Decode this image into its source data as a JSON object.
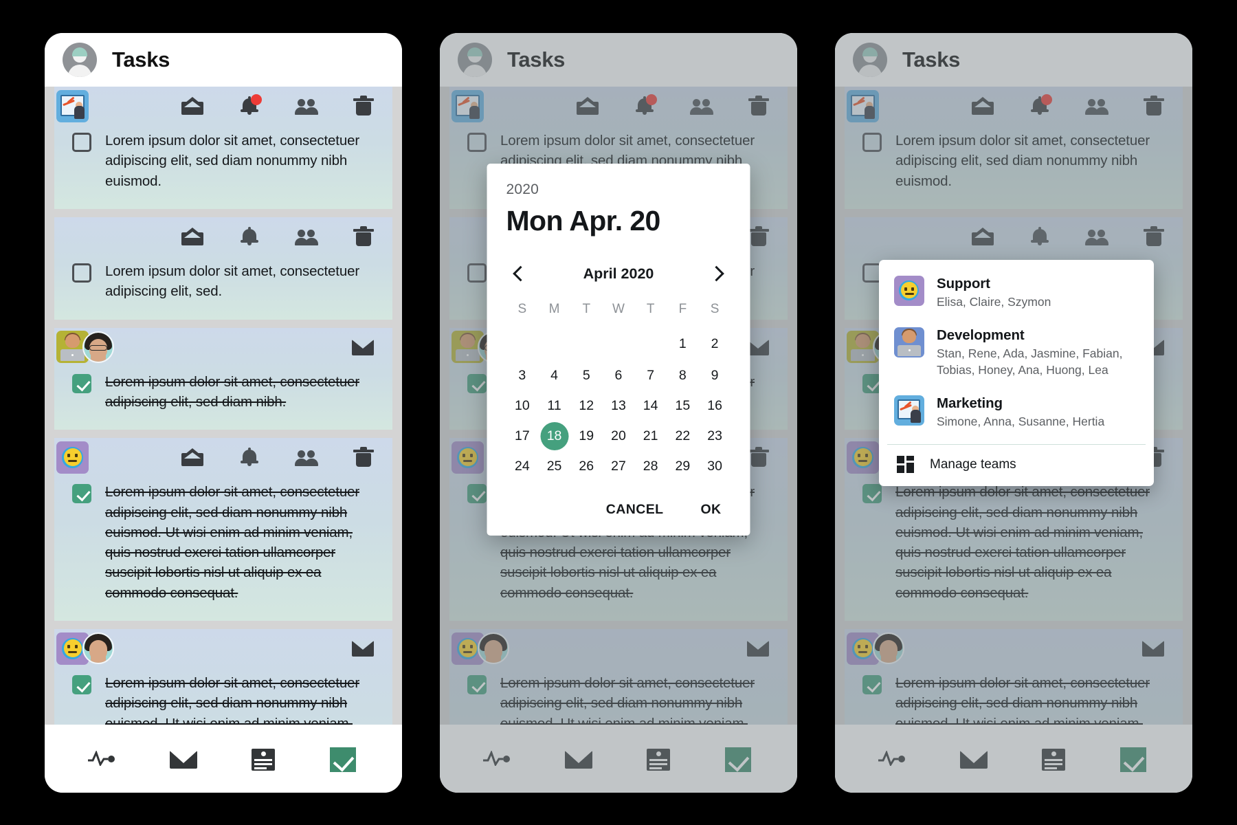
{
  "app": {
    "title": "Tasks",
    "accent_green": "#45a07e",
    "badge_red": "#ed3b37",
    "card_gradient_top": "#cdd9ea",
    "card_gradient_bottom": "#d4e7e0"
  },
  "header": {
    "title": "Tasks",
    "avatar_name": "user-avatar"
  },
  "tasks": [
    {
      "id": "task-1",
      "team_badge": "marketing-badge-icon",
      "avatars": [],
      "icons": [
        "mail-icon",
        "bell-icon",
        "people-icon",
        "trash-icon"
      ],
      "bell_badge": true,
      "checked": false,
      "text": "Lorem ipsum dolor sit amet, consectetuer adipiscing elit, sed diam nonummy nibh euismod."
    },
    {
      "id": "task-2",
      "team_badge": null,
      "avatars": [],
      "icons": [
        "mail-icon",
        "bell-icon",
        "people-icon",
        "trash-icon"
      ],
      "bell_badge": false,
      "checked": false,
      "text": "Lorem ipsum dolor sit amet, consectetuer adipiscing elit, sed."
    },
    {
      "id": "task-3",
      "team_badge": "development-badge-icon",
      "avatars": [
        "avatar-woman-glasses"
      ],
      "icons": [
        "mail-icon"
      ],
      "bell_badge": false,
      "checked": true,
      "text": "Lorem ipsum dolor sit amet, consectetuer adipiscing elit, sed diam nibh."
    },
    {
      "id": "task-4",
      "team_badge": "support-badge-icon",
      "avatars": [],
      "icons": [
        "mail-icon",
        "bell-icon",
        "people-icon",
        "trash-icon"
      ],
      "bell_badge": false,
      "checked": true,
      "text": "Lorem ipsum dolor sit amet, consectetuer adipiscing elit, sed diam nonummy nibh euismod. Ut wisi enim ad minim veniam, quis nostrud exerci tation ullamcorper suscipit lobortis nisl ut aliquip ex ea commodo consequat."
    },
    {
      "id": "task-5",
      "team_badge": "support-badge-icon",
      "avatars": [
        "avatar-woman-short-hair"
      ],
      "icons": [
        "mail-icon"
      ],
      "bell_badge": false,
      "checked": true,
      "text": "Lorem ipsum dolor sit amet, consectetuer adipiscing elit, sed diam nonummy nibh euismod. Ut wisi enim ad minim veniam, quis nostrud exerci tation ullamcorper suscipit lobortis nisl ut aliquip ex ea commodo consequat."
    }
  ],
  "bottom_nav": [
    {
      "id": "nav-activity",
      "icon": "pulse-icon",
      "active": false
    },
    {
      "id": "nav-mail",
      "icon": "mail-icon",
      "active": false
    },
    {
      "id": "nav-cards",
      "icon": "card-list-icon",
      "active": false
    },
    {
      "id": "nav-tasks",
      "icon": "check-icon",
      "active": true
    }
  ],
  "date_picker": {
    "year": "2020",
    "selected_date_label": "Mon Apr. 20",
    "month_label": "April 2020",
    "prev_icon": "chevron-left-icon",
    "next_icon": "chevron-right-icon",
    "weekdays": [
      "S",
      "M",
      "T",
      "W",
      "T",
      "F",
      "S"
    ],
    "weeks": [
      [
        "",
        "",
        "",
        "",
        "",
        "1",
        "2"
      ],
      [
        "3",
        "4",
        "5",
        "6",
        "7",
        "8",
        "9"
      ],
      [
        "10",
        "11",
        "12",
        "13",
        "14",
        "15",
        "16"
      ],
      [
        "17",
        "18",
        "19",
        "20",
        "21",
        "22",
        "23"
      ],
      [
        "24",
        "25",
        "26",
        "27",
        "28",
        "29",
        "30"
      ]
    ],
    "selected_day": "18",
    "cancel_label": "CANCEL",
    "ok_label": "OK"
  },
  "teams_menu": {
    "teams": [
      {
        "name": "Support",
        "icon": "support-team-icon",
        "members": "Elisa, Claire, Szymon"
      },
      {
        "name": "Development",
        "icon": "development-team-icon",
        "members": "Stan, Rene, Ada, Jasmine, Fabian, Tobias, Honey, Ana, Huong, Lea"
      },
      {
        "name": "Marketing",
        "icon": "marketing-team-icon",
        "members": "Simone, Anna, Susanne, Hertia"
      }
    ],
    "manage_label": "Manage teams",
    "manage_icon": "grid-icon"
  }
}
